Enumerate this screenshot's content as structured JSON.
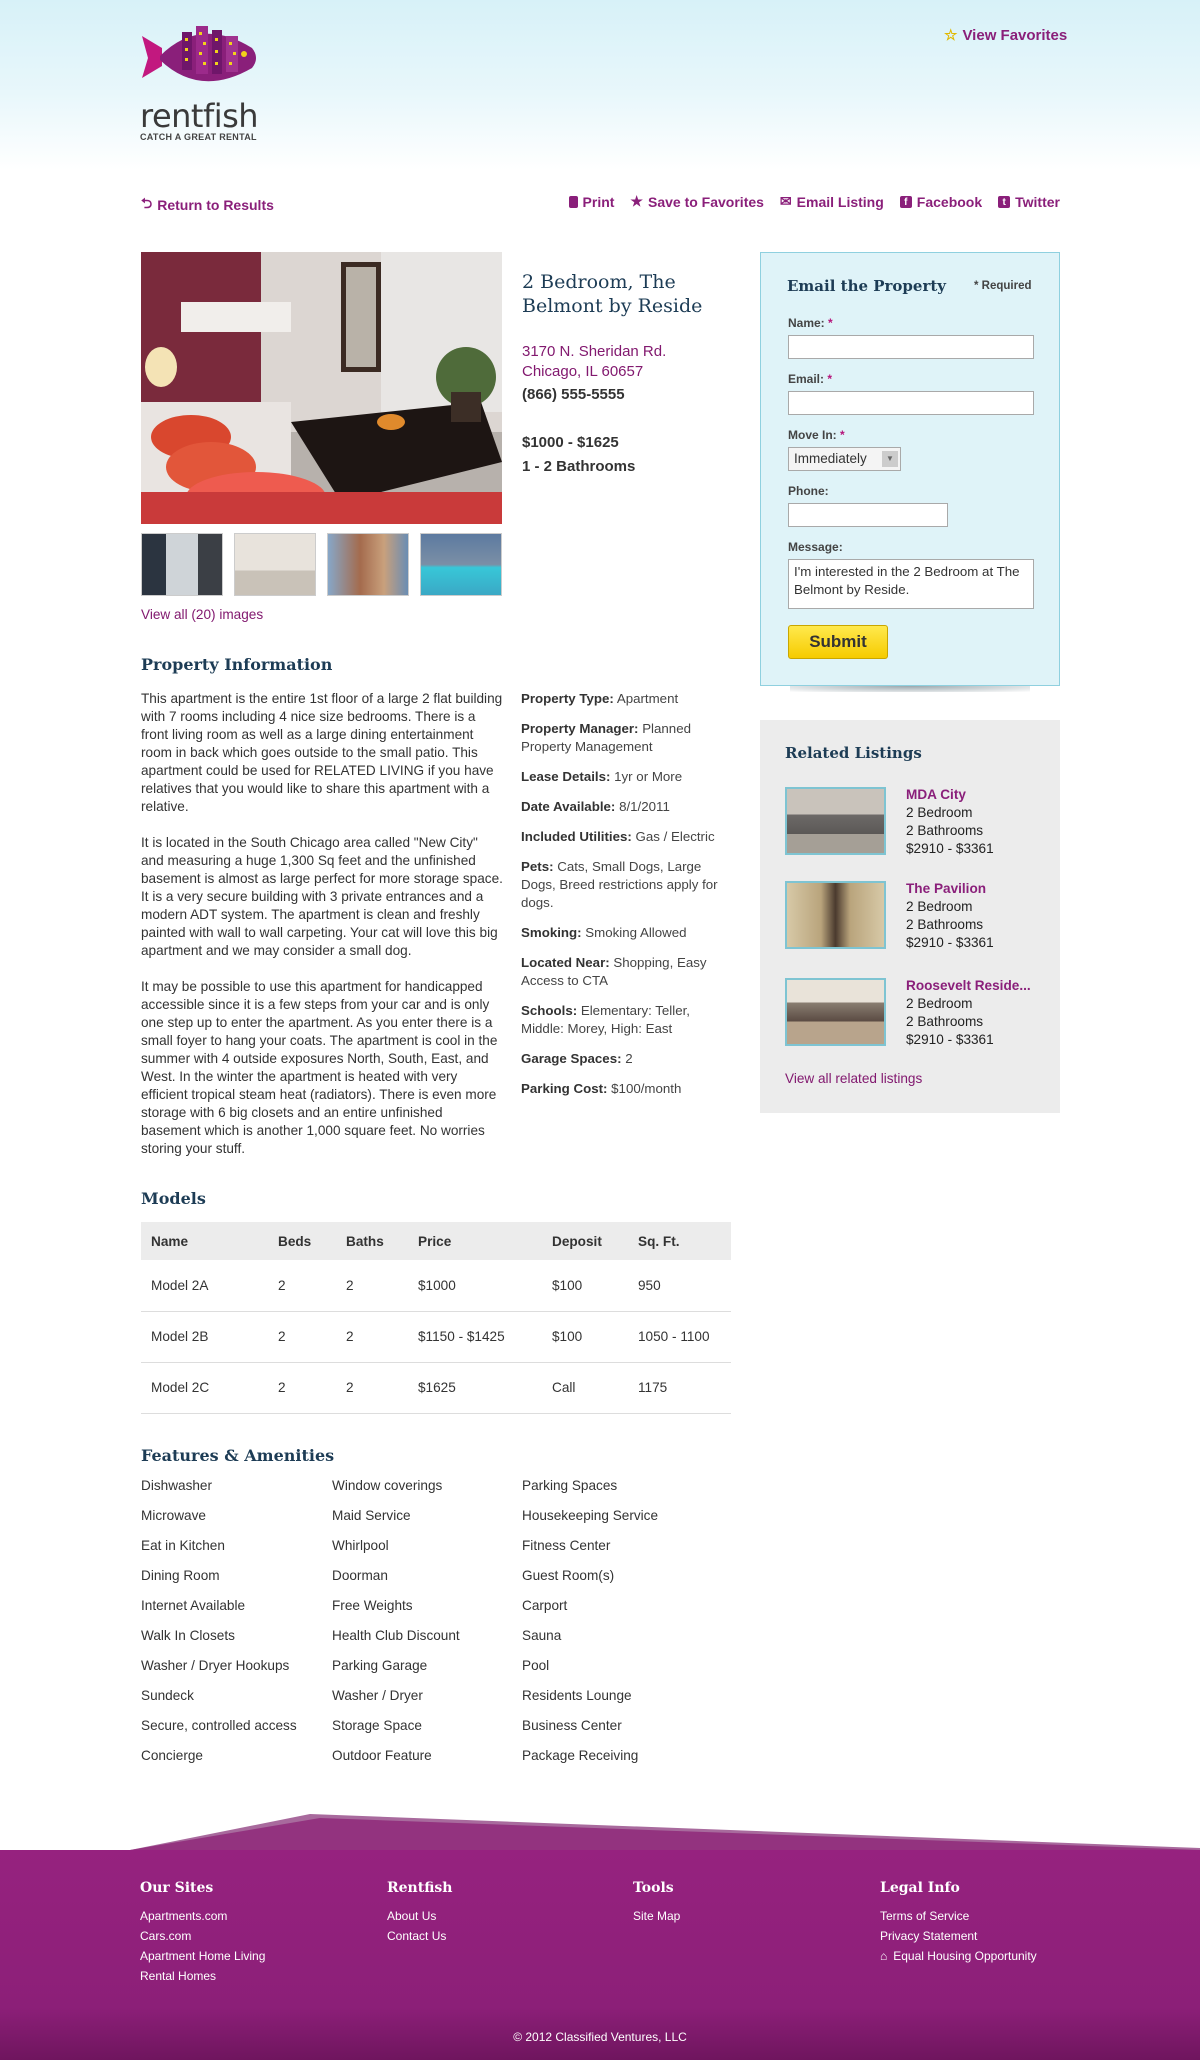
{
  "header": {
    "brand": "rentfish",
    "tagline": "CATCH A GREAT RENTAL",
    "view_favorites": "View Favorites"
  },
  "actions": {
    "return": "Return to Results",
    "print": "Print",
    "save": "Save to Favorites",
    "email": "Email Listing",
    "facebook": "Facebook",
    "twitter": "Twitter"
  },
  "listing": {
    "title_line1": "2 Bedroom, The",
    "title_line2": "Belmont by Reside",
    "address_line1": "3170 N. Sheridan Rd.",
    "address_line2": "Chicago, IL 60657",
    "phone": "(866) 555-5555",
    "price": "$1000 - $1625",
    "baths": "1 - 2 Bathrooms",
    "view_all_images": "View all (20) images"
  },
  "property_info": {
    "heading": "Property Information",
    "paragraphs": [
      "This apartment is the entire 1st floor of a large 2 flat building with 7 rooms including 4 nice size bedrooms. There is a front living room as well as a large dining entertainment room in back which goes outside to the small patio. This apartment could be used for RELATED LIVING if you have relatives that you would like to share this apartment with a relative.",
      "It is located in the South Chicago area called \"New City\" and measuring a huge 1,300 Sq feet and the unfinished basement is almost as large perfect for more storage space. It is a very secure building with 3 private entrances and a modern ADT system. The apartment is clean and freshly painted with wall to wall carpeting. Your cat will love this big apartment and we may consider a small dog.",
      "It may be possible to use this apartment for handicapped accessible since it is a few steps from your car and is only one step up to enter the apartment. As you enter there is a small foyer to hang your coats. The apartment is cool in the summer with 4 outside exposures North, South, East, and West. In the winter the apartment is heated with very efficient tropical steam heat (radiators). There is even more storage with 6 big closets and an entire unfinished basement which is another 1,000 square feet. No worries storing your stuff."
    ],
    "details": [
      {
        "label": "Property Type:",
        "value": "Apartment"
      },
      {
        "label": "Property Manager:",
        "value": "Planned Property Management"
      },
      {
        "label": "Lease Details:",
        "value": "1yr or More"
      },
      {
        "label": "Date Available:",
        "value": "8/1/2011"
      },
      {
        "label": "Included Utilities:",
        "value": "Gas / Electric"
      },
      {
        "label": "Pets:",
        "value": "Cats, Small Dogs, Large Dogs, Breed restrictions apply for dogs."
      },
      {
        "label": "Smoking:",
        "value": "Smoking Allowed"
      },
      {
        "label": "Located Near:",
        "value": "Shopping, Easy Access to CTA"
      },
      {
        "label": "Schools:",
        "value": "Elementary: Teller, Middle: Morey, High: East"
      },
      {
        "label": "Garage Spaces:",
        "value": "2"
      },
      {
        "label": "Parking Cost:",
        "value": "$100/month"
      }
    ]
  },
  "email_form": {
    "heading": "Email the Property",
    "required_note": "* Required",
    "name_label": "Name:",
    "email_label": "Email:",
    "move_in_label": "Move In:",
    "move_in_value": "Immediately",
    "phone_label": "Phone:",
    "message_label": "Message:",
    "message_value": "I'm interested in the 2 Bedroom at The Belmont by Reside.",
    "asterisk": "*",
    "submit": "Submit"
  },
  "related": {
    "heading": "Related Listings",
    "items": [
      {
        "name": "MDA City",
        "beds": "2 Bedroom",
        "baths": "2 Bathrooms",
        "price": "$2910 - $3361"
      },
      {
        "name": "The Pavilion",
        "beds": "2 Bedroom",
        "baths": "2 Bathrooms",
        "price": "$2910 - $3361"
      },
      {
        "name": "Roosevelt Reside...",
        "beds": "2 Bedroom",
        "baths": "2 Bathrooms",
        "price": "$2910 - $3361"
      }
    ],
    "view_all": "View all related listings"
  },
  "models": {
    "heading": "Models",
    "columns": [
      "Name",
      "Beds",
      "Baths",
      "Price",
      "Deposit",
      "Sq. Ft."
    ],
    "rows": [
      [
        "Model 2A",
        "2",
        "2",
        "$1000",
        "$100",
        "950"
      ],
      [
        "Model 2B",
        "2",
        "2",
        "$1150 - $1425",
        "$100",
        "1050 - 1100"
      ],
      [
        "Model 2C",
        "2",
        "2",
        "$1625",
        "Call",
        "1175"
      ]
    ]
  },
  "amenities": {
    "heading": "Features & Amenities",
    "col1": [
      "Dishwasher",
      "Microwave",
      "Eat in Kitchen",
      "Dining Room",
      "Internet Available",
      "Walk In Closets",
      "Washer / Dryer Hookups",
      "Sundeck",
      "Secure, controlled access",
      "Concierge"
    ],
    "col2": [
      "Window coverings",
      "Maid Service",
      "Whirlpool",
      "Doorman",
      "Free Weights",
      "Health Club Discount",
      "Parking Garage",
      "Washer / Dryer",
      "Storage Space",
      "Outdoor Feature"
    ],
    "col3": [
      "Parking Spaces",
      "Housekeeping Service",
      "Fitness Center",
      "Guest Room(s)",
      "Carport",
      "Sauna",
      "Pool",
      "Residents Lounge",
      "Business Center",
      "Package Receiving"
    ]
  },
  "footer": {
    "our_sites": {
      "heading": "Our Sites",
      "links": [
        "Apartments.com",
        "Cars.com",
        "Apartment Home Living",
        "Rental Homes"
      ]
    },
    "rentfish": {
      "heading": "Rentfish",
      "links": [
        "About Us",
        "Contact Us"
      ]
    },
    "tools": {
      "heading": "Tools",
      "links": [
        "Site Map"
      ]
    },
    "legal": {
      "heading": "Legal Info",
      "links": [
        "Terms of Service",
        "Privacy Statement",
        "Equal Housing Opportunity"
      ]
    },
    "copyright": "© 2012 Classified Ventures, LLC"
  },
  "colors": {
    "brand_purple": "#8a1f7a",
    "heading_navy": "#1d3c55",
    "form_bg": "#dff3f8",
    "submit_yellow": "#f6cb00"
  }
}
